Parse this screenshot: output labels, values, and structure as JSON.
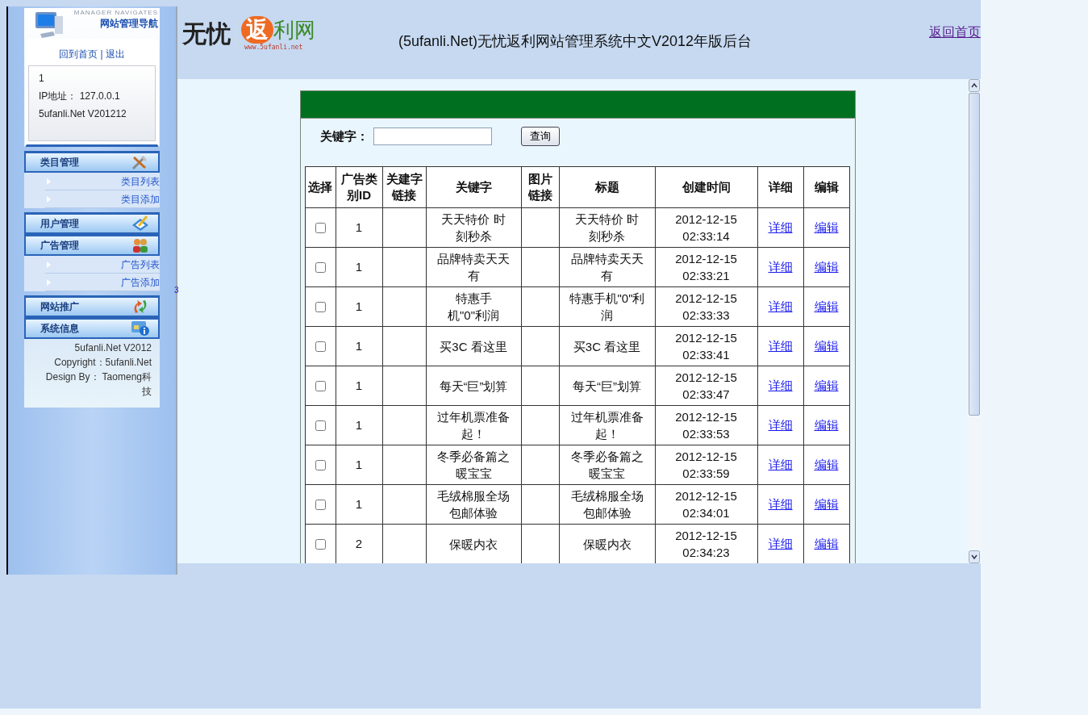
{
  "sidebar": {
    "subtitle": "MANAGER NAVIGATES",
    "title": "网站管理导航",
    "links": [
      "回到首页",
      "退出"
    ],
    "separator": "|",
    "info": [
      "1",
      "IP地址： 127.0.0.1",
      "5ufanli.Net V201212"
    ],
    "groups": [
      {
        "sections": [
          {
            "label": "类目管理",
            "kind": "tools",
            "items": [
              "类目列表",
              "类目添加"
            ]
          }
        ]
      },
      {
        "sections": [
          {
            "label": "用户管理",
            "kind": "pencil"
          },
          {
            "label": "广告管理",
            "kind": "people",
            "items": [
              "广告列表",
              "广告添加"
            ]
          }
        ]
      },
      {
        "sections": [
          {
            "label": "网站推广",
            "kind": "arrows"
          },
          {
            "label": "系统信息",
            "kind": "info"
          }
        ]
      }
    ],
    "footer": [
      "5ufanli.Net V2012",
      "Copyright：5ufanli.Net",
      "Design By： Taomeng科技"
    ],
    "stray": "3"
  },
  "header": {
    "logo": {
      "left": "无忧",
      "badge": "返",
      "right": "利网",
      "url": "www.5ufanli.net"
    },
    "title": "(5ufanli.Net)无忧返利网站管理系统中文V2012年版后台",
    "home_link": "返回首页"
  },
  "search": {
    "label": "关键字：",
    "button": "查询"
  },
  "table": {
    "columns": [
      "选择",
      "广告类别ID",
      "关建字链接",
      "关键字",
      "图片链接",
      "标题",
      "创建时间",
      "详细",
      "编辑"
    ],
    "rows": [
      {
        "checked": false,
        "category_id": "1",
        "keyword": "天天特价 时刻秒杀",
        "title": "天天特价 时刻秒杀",
        "created": "2012-12-15 02:33:14",
        "detail": "详细",
        "edit": "编辑"
      },
      {
        "checked": false,
        "category_id": "1",
        "keyword": "品牌特卖天天有",
        "title": "品牌特卖天天有",
        "created": "2012-12-15 02:33:21",
        "detail": "详细",
        "edit": "编辑"
      },
      {
        "checked": false,
        "category_id": "1",
        "keyword": "特惠手机\"0\"利润",
        "title": "特惠手机\"0\"利润",
        "created": "2012-12-15 02:33:33",
        "detail": "详细",
        "edit": "编辑"
      },
      {
        "checked": false,
        "category_id": "1",
        "keyword": "买3C 看这里",
        "title": "买3C 看这里",
        "created": "2012-12-15 02:33:41",
        "detail": "详细",
        "edit": "编辑"
      },
      {
        "checked": false,
        "category_id": "1",
        "keyword": "每天“巨”划算",
        "title": "每天“巨”划算",
        "created": "2012-12-15 02:33:47",
        "detail": "详细",
        "edit": "编辑"
      },
      {
        "checked": false,
        "category_id": "1",
        "keyword": "过年机票准备起！",
        "title": "过年机票准备起！",
        "created": "2012-12-15 02:33:53",
        "detail": "详细",
        "edit": "编辑"
      },
      {
        "checked": false,
        "category_id": "1",
        "keyword": "冬季必备篇之暖宝宝",
        "title": "冬季必备篇之暖宝宝",
        "created": "2012-12-15 02:33:59",
        "detail": "详细",
        "edit": "编辑"
      },
      {
        "checked": false,
        "category_id": "1",
        "keyword": "毛绒棉服全场包邮体验",
        "title": "毛绒棉服全场包邮体验",
        "created": "2012-12-15 02:34:01",
        "detail": "详细",
        "edit": "编辑"
      },
      {
        "checked": false,
        "category_id": "2",
        "keyword": "保暖内衣",
        "title": "保暖内衣",
        "created": "2012-12-15 02:34:23",
        "detail": "详细",
        "edit": "编辑"
      }
    ]
  }
}
